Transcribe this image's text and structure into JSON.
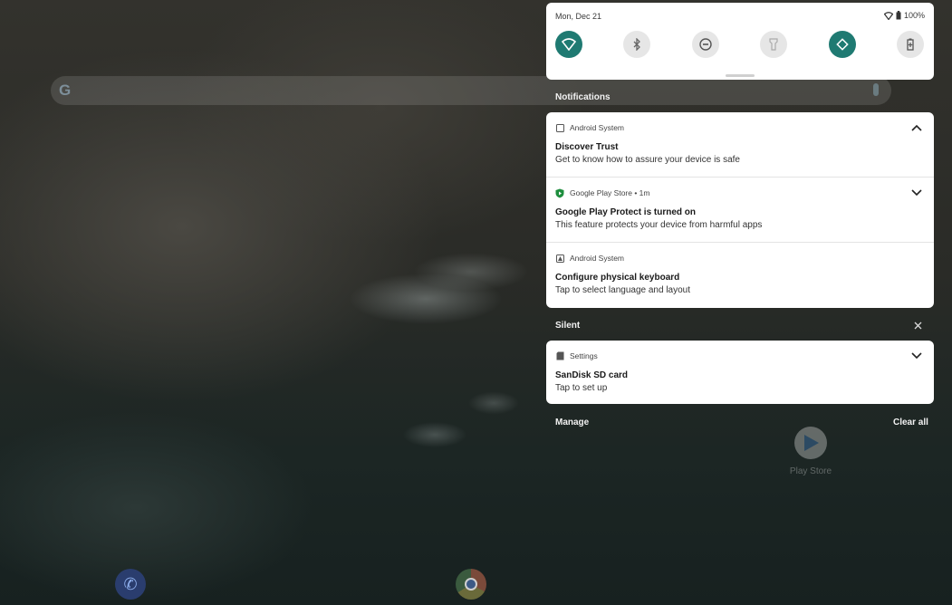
{
  "status": {
    "date": "Mon, Dec 21",
    "battery": "100%"
  },
  "quick_settings": [
    {
      "name": "wifi",
      "on": true
    },
    {
      "name": "bluetooth",
      "on": false
    },
    {
      "name": "do-not-disturb",
      "on": false
    },
    {
      "name": "flashlight",
      "on": false
    },
    {
      "name": "auto-rotate",
      "on": true
    },
    {
      "name": "battery-saver",
      "on": false
    }
  ],
  "sections": {
    "notifications": "Notifications",
    "silent": "Silent"
  },
  "notifications": [
    {
      "app": "Android System",
      "title": "Discover Trust",
      "body": "Get to know how to assure your device is safe",
      "expanded": true
    },
    {
      "app": "Google Play Store • 1m",
      "title": "Google Play Protect is turned on",
      "body": "This feature protects your device from harmful apps",
      "expanded": false
    },
    {
      "app": "Android System",
      "title": "Configure physical keyboard",
      "body": "Tap to select language and layout",
      "expanded": false
    }
  ],
  "silent_notifications": [
    {
      "app": "Settings",
      "title": "SanDisk SD card",
      "body": "Tap to set up",
      "expanded": false
    }
  ],
  "footer": {
    "manage": "Manage",
    "clear_all": "Clear all"
  },
  "home": {
    "play_store_label": "Play Store"
  },
  "colors": {
    "accent": "#1f7a72",
    "card": "#ffffff"
  }
}
